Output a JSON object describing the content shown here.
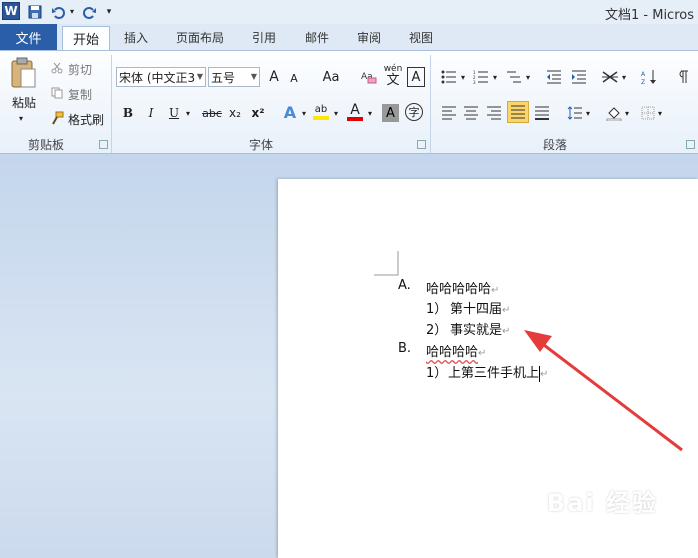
{
  "window": {
    "title": "文档1 - Micros"
  },
  "tabs": [
    {
      "label": "文件"
    },
    {
      "label": "开始"
    },
    {
      "label": "插入"
    },
    {
      "label": "页面布局"
    },
    {
      "label": "引用"
    },
    {
      "label": "邮件"
    },
    {
      "label": "审阅"
    },
    {
      "label": "视图"
    }
  ],
  "clipboard": {
    "paste": "粘贴",
    "cut": "剪切",
    "copy": "复制",
    "format_painter": "格式刷",
    "group": "剪贴板"
  },
  "font": {
    "name": "宋体 (中文正3",
    "size": "五号",
    "grow": "A",
    "shrink": "A",
    "case": "Aa",
    "bold": "B",
    "italic": "I",
    "underline": "U",
    "strike": "abc",
    "sub": "x₂",
    "sup": "x²",
    "color_a": "A",
    "highlight": "ab",
    "shade": "A",
    "enclose": "字",
    "pinyin": "wén",
    "group": "字体"
  },
  "paragraph": {
    "group": "段落"
  },
  "document": {
    "lines": [
      {
        "label": "A.",
        "text": "哈哈哈哈哈"
      },
      {
        "label": "1）",
        "text": "第十四届"
      },
      {
        "label": "2）",
        "text": "事实就是"
      },
      {
        "label": "B.",
        "text": "哈哈哈哈"
      },
      {
        "label": "1）",
        "text": "上第三件手机上"
      }
    ],
    "para_mark": "↵"
  },
  "watermark": "Bai 经验",
  "colors": {
    "accent": "#2a5ea8",
    "arrow": "#e53b3b"
  }
}
